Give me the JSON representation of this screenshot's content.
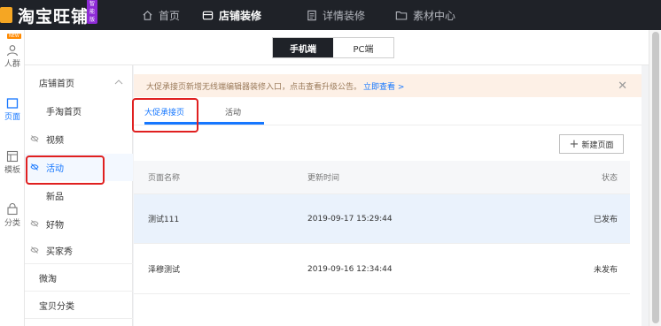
{
  "brand": {
    "name": "淘宝旺铺",
    "badge": "智能版"
  },
  "topnav": [
    {
      "label": "首页",
      "icon": "home-icon"
    },
    {
      "label": "店铺装修",
      "icon": "store-icon"
    },
    {
      "label": "详情装修",
      "icon": "document-icon"
    },
    {
      "label": "素材中心",
      "icon": "folder-icon"
    }
  ],
  "rail": {
    "new_badge": "NEW",
    "items": [
      {
        "label": "人群",
        "icon": "user-icon"
      },
      {
        "label": "页面",
        "icon": "page-icon"
      },
      {
        "label": "模板",
        "icon": "template-icon"
      },
      {
        "label": "分类",
        "icon": "category-icon"
      }
    ]
  },
  "device_toggle": {
    "mobile": "手机端",
    "pc": "PC端"
  },
  "sidebar": [
    {
      "label": "店铺首页"
    },
    {
      "label": "手淘首页"
    },
    {
      "label": "视频"
    },
    {
      "label": "活动"
    },
    {
      "label": "新品"
    },
    {
      "label": "好物"
    },
    {
      "label": "买家秀"
    },
    {
      "label": "微淘"
    },
    {
      "label": "宝贝分类"
    }
  ],
  "notice": {
    "text": "大促承接页新增无线端编辑器装修入口，点击查看升级公告。",
    "link": "立即查看 >"
  },
  "tabs": [
    {
      "label": "大促承接页"
    },
    {
      "label": "活动"
    }
  ],
  "new_page_button": "新建页面",
  "table": {
    "headers": {
      "name": "页面名称",
      "time": "更新时间",
      "status": "状态"
    },
    "rows": [
      {
        "name": "测试111",
        "time": "2019-09-17 15:29:44",
        "status": "已发布"
      },
      {
        "name": "泽穆测试",
        "time": "2019-09-16 12:34:44",
        "status": "未发布"
      }
    ]
  }
}
